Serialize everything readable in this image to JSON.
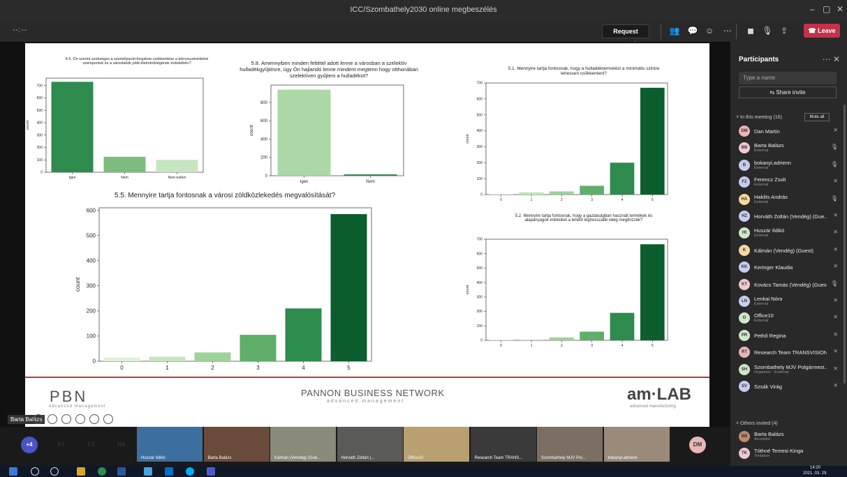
{
  "window": {
    "title": "ICC/Szombathely2030 online megbeszélés"
  },
  "toolbar": {
    "left_text": "--:--",
    "request_control": "Request control",
    "leave": "Leave"
  },
  "slide": {
    "footer": {
      "pbn_logo": "PBN",
      "pbn_sub": "advanced management",
      "center_title": "PANNON BUSINESS NETWORK",
      "center_sub": "advanced management",
      "amlab": "am·LAB",
      "amlab_sub": "advanced manufacturing"
    }
  },
  "chart_data": [
    {
      "type": "bar",
      "title": "4.5. Ön szerint szükséges a személyautó-forgalom csökkentése a környezetvédelmi szempontok és a városlakók jobb életminőségének érdekében?",
      "categories": [
        "Igen",
        "Nem",
        "Nem tudom"
      ],
      "values": [
        730,
        125,
        100
      ],
      "ylabel": "count",
      "ylim": [
        0,
        760
      ],
      "yticks": [
        0,
        100,
        200,
        300,
        400,
        500,
        600,
        700
      ],
      "colors": [
        "#2e8b4e",
        "#7cbd7f",
        "#c6e5c0"
      ]
    },
    {
      "type": "bar",
      "title": "5.8. Amennyiben minden feltétel adott lenne a városban a szelektív hulladékgyűjtésre, úgy Ön hajlandó lenne mindent megtenn hogy otthonában szelektíven gyűjteni a hulladékot?",
      "categories": [
        "Igen",
        "Nem"
      ],
      "values": [
        940,
        15
      ],
      "ylabel": "count",
      "ylim": [
        0,
        990
      ],
      "yticks": [
        0,
        200,
        400,
        600,
        800
      ],
      "colors": [
        "#acd7a6",
        "#2e8b4e"
      ]
    },
    {
      "type": "bar",
      "title": "5.1. Mennyire tartja fontosnak, hogy a hulladéktermelést a minimális szintre lehessen csökkenteni?",
      "categories": [
        "0",
        "1",
        "2",
        "3",
        "4",
        "5"
      ],
      "values": [
        5,
        15,
        20,
        55,
        200,
        670
      ],
      "ylabel": "count",
      "ylim": [
        0,
        700
      ],
      "yticks": [
        0,
        100,
        200,
        300,
        400,
        500,
        600,
        700
      ],
      "colors": [
        "#e0f2da",
        "#c4e5bc",
        "#9fd19a",
        "#5fae6a",
        "#2e8b4e",
        "#0c5e2e"
      ]
    },
    {
      "type": "bar",
      "title": "5.5. Mennyire tartja fontosnak a városi zöldközlekedés megvalósítását?",
      "categories": [
        "0",
        "1",
        "2",
        "3",
        "4",
        "5"
      ],
      "values": [
        15,
        18,
        35,
        105,
        210,
        585
      ],
      "ylabel": "count",
      "ylim": [
        0,
        610
      ],
      "yticks": [
        0,
        100,
        200,
        300,
        400,
        500,
        600
      ],
      "colors": [
        "#dff0d8",
        "#c6e5bc",
        "#9fd19a",
        "#5fae6a",
        "#2e8b4e",
        "#0c5e2e"
      ]
    },
    {
      "type": "bar",
      "title": "5.2. Mennyire tartja fontosnak, hogy a gazdaságban használt termékek és alapanyagok értéküket a lehető leghosszabb ideig megőrizzék?",
      "categories": [
        "0",
        "1",
        "2",
        "3",
        "4",
        "5"
      ],
      "values": [
        5,
        5,
        20,
        60,
        190,
        665
      ],
      "ylabel": "count",
      "ylim": [
        0,
        700
      ],
      "yticks": [
        0,
        100,
        200,
        300,
        400,
        500,
        600,
        700
      ],
      "colors": [
        "#e0f2da",
        "#c4e5bc",
        "#9fd19a",
        "#5fae6a",
        "#2e8b4e",
        "#0c5e2e"
      ]
    }
  ],
  "presenter_label": "Barta Balázs",
  "participants": {
    "title": "Participants",
    "search_placeholder": "Type a name",
    "share_invite": "Share invite",
    "in_meeting_label": "In this meeting (16)",
    "mute_all": "Mute all",
    "others_label": "Others invited (4)",
    "list": [
      {
        "initials": "DM",
        "name": "Dan Martin",
        "sub": "",
        "color": "#e8b6b6",
        "mic": "muted"
      },
      {
        "initials": "BB",
        "name": "Barta Balázs",
        "sub": "External",
        "color": "#f0c8d2",
        "mic": "on"
      },
      {
        "initials": "B",
        "name": "bokanyi.adrienn",
        "sub": "External",
        "color": "#c7cdef",
        "mic": "on"
      },
      {
        "initials": "FZ",
        "name": "Ferencz Zsolt",
        "sub": "External",
        "color": "#c7cdef",
        "mic": "muted"
      },
      {
        "initials": "HA",
        "name": "Haklits András",
        "sub": "External",
        "color": "#f4d9a0",
        "mic": "on"
      },
      {
        "initials": "HZ",
        "name": "Horváth Zoltán (Vendég) (Gue...",
        "sub": "",
        "color": "#c7cdef",
        "mic": "muted"
      },
      {
        "initials": "HI",
        "name": "Huszár Ildikó",
        "sub": "External",
        "color": "#cfe6c7",
        "mic": "muted"
      },
      {
        "initials": "K",
        "name": "Kálmán (Vendég) (Guest)",
        "sub": "",
        "color": "#f4d9a0",
        "mic": "muted"
      },
      {
        "initials": "KK",
        "name": "Keringer Klaudia",
        "sub": "",
        "color": "#c7cdef",
        "mic": "muted"
      },
      {
        "initials": "KT",
        "name": "Kovács Tamás (Vendég) (Guest)",
        "sub": "",
        "color": "#f0c8d2",
        "mic": "on"
      },
      {
        "initials": "LN",
        "name": "Lenkai Nóra",
        "sub": "External",
        "color": "#c7cdef",
        "mic": "muted"
      },
      {
        "initials": "O",
        "name": "Office10",
        "sub": "External",
        "color": "#cfe6c7",
        "mic": "muted"
      },
      {
        "initials": "PR",
        "name": "Pethő Regina",
        "sub": "",
        "color": "#cfe6c7",
        "mic": "muted"
      },
      {
        "initials": "RT",
        "name": "Research Team TRANSVISION...",
        "sub": "",
        "color": "#e8b6b6",
        "mic": "muted"
      },
      {
        "initials": "SH",
        "name": "Szombathely MJV Polgármest...",
        "sub": "Organizer",
        "sub2": "External",
        "color": "#cfe6c7",
        "mic": "muted"
      },
      {
        "initials": "SV",
        "name": "Szsák Virág",
        "sub": "",
        "color": "#c7cdef",
        "mic": "muted"
      }
    ],
    "invited": [
      {
        "initials": "BB",
        "name": "Barta Balázs",
        "sub": "Accepted",
        "color": "#c08a6a"
      },
      {
        "initials": "TK",
        "name": "Tóthné Temesi Kinga",
        "sub": "Tentative",
        "color": "#f0c8d2"
      }
    ]
  },
  "video_strip": {
    "more": "+4",
    "avatars": [
      {
        "initials": "KT",
        "color": "#f0c8d2"
      },
      {
        "initials": "FZ",
        "color": "#c7cdef"
      },
      {
        "initials": "HA",
        "color": "#f4d9a0"
      }
    ],
    "tiles": [
      {
        "label": "Huszár Ildikó",
        "color": "#3d6f9e"
      },
      {
        "label": "Barta Balázs",
        "color": "#6a4a3a"
      },
      {
        "label": "Kálmán (Vendég) (Gue...",
        "color": "#8a8a7a"
      },
      {
        "label": "Horváth Zoltán (...",
        "color": "#5a5a58"
      },
      {
        "label": "Office10",
        "color": "#b8a070"
      },
      {
        "label": "Research Team TRANS...",
        "color": "#3a3a3a"
      },
      {
        "label": "Szombathely MJV Pol...",
        "color": "#7a6f62"
      },
      {
        "label": "bokanyi.adrienn",
        "color": "#9a8a7a"
      }
    ],
    "dm_avatar": "DM"
  },
  "taskbar": {
    "time": "14:20",
    "date": "2021. 03. 29."
  }
}
